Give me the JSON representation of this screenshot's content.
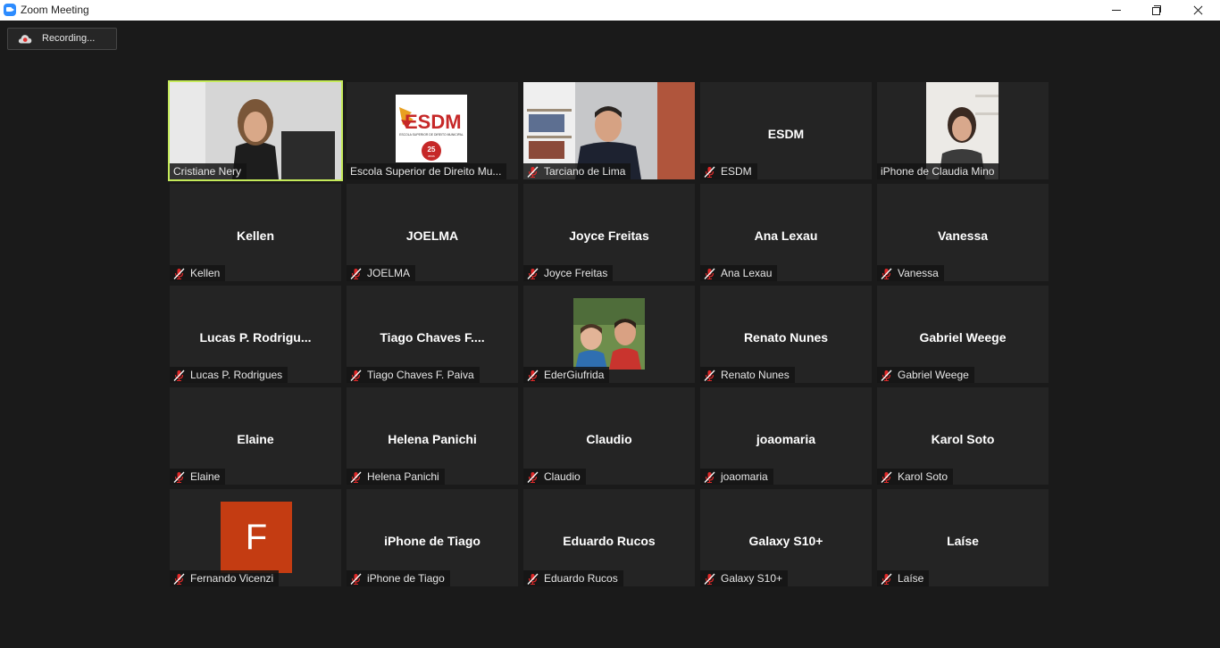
{
  "window": {
    "title": "Zoom Meeting"
  },
  "recording": {
    "label": "Recording..."
  },
  "esdm_logo": {
    "text": "ESDM",
    "subtitle": "ESCOLA SUPERIOR DE DIREITO MUNICIPAL",
    "badge_number": "25",
    "badge_text": "anos"
  },
  "participants": [
    {
      "display_name": "",
      "tag": "Cristiane Nery",
      "video": "video",
      "active": true,
      "muted": false
    },
    {
      "display_name": "",
      "tag": "Escola Superior de Direito Mu...",
      "video": "logo",
      "muted": false
    },
    {
      "display_name": "",
      "tag": "Tarciano de Lima",
      "video": "video",
      "muted": true
    },
    {
      "display_name": "ESDM",
      "tag": "ESDM",
      "video": "none",
      "muted": true
    },
    {
      "display_name": "",
      "tag": "iPhone de Claudia Mino",
      "video": "video",
      "muted": false
    },
    {
      "display_name": "Kellen",
      "tag": "Kellen",
      "video": "none",
      "muted": true
    },
    {
      "display_name": "JOELMA",
      "tag": "JOELMA",
      "video": "none",
      "muted": true
    },
    {
      "display_name": "Joyce Freitas",
      "tag": "Joyce Freitas",
      "video": "none",
      "muted": true
    },
    {
      "display_name": "Ana Lexau",
      "tag": "Ana Lexau",
      "video": "none",
      "muted": true
    },
    {
      "display_name": "Vanessa",
      "tag": "Vanessa",
      "video": "none",
      "muted": true
    },
    {
      "display_name": "Lucas  P.  Rodrigu...",
      "tag": "Lucas P. Rodrigues",
      "video": "none",
      "muted": true
    },
    {
      "display_name": "Tiago  Chaves  F....",
      "tag": "Tiago Chaves F. Paiva",
      "video": "none",
      "muted": true
    },
    {
      "display_name": "",
      "tag": "EderGiufrida",
      "video": "photo",
      "muted": true
    },
    {
      "display_name": "Renato Nunes",
      "tag": "Renato Nunes",
      "video": "none",
      "muted": true
    },
    {
      "display_name": "Gabriel Weege",
      "tag": "Gabriel Weege",
      "video": "none",
      "muted": true
    },
    {
      "display_name": "Elaine",
      "tag": "Elaine",
      "video": "none",
      "muted": true
    },
    {
      "display_name": "Helena Panichi",
      "tag": "Helena Panichi",
      "video": "none",
      "muted": true
    },
    {
      "display_name": "Claudio",
      "tag": "Claudio",
      "video": "none",
      "muted": true
    },
    {
      "display_name": "joaomaria",
      "tag": "joaomaria",
      "video": "none",
      "muted": true
    },
    {
      "display_name": "Karol Soto",
      "tag": "Karol Soto",
      "video": "none",
      "muted": true
    },
    {
      "display_name": "F",
      "tag": "Fernando Vicenzi",
      "video": "avatar",
      "avatar_color": "#c43c12",
      "muted": true
    },
    {
      "display_name": "iPhone de Tiago",
      "tag": "iPhone de Tiago",
      "video": "none",
      "muted": true
    },
    {
      "display_name": "Eduardo Rucos",
      "tag": "Eduardo Rucos",
      "video": "none",
      "muted": true
    },
    {
      "display_name": "Galaxy S10+",
      "tag": "Galaxy S10+",
      "video": "none",
      "muted": true
    },
    {
      "display_name": "Laíse",
      "tag": "Laíse",
      "video": "none",
      "muted": true
    }
  ],
  "colors": {
    "background": "#1a1a1a",
    "tile": "#242424",
    "active_speaker": "#c5ea5a",
    "muted_icon": "#e02828"
  }
}
